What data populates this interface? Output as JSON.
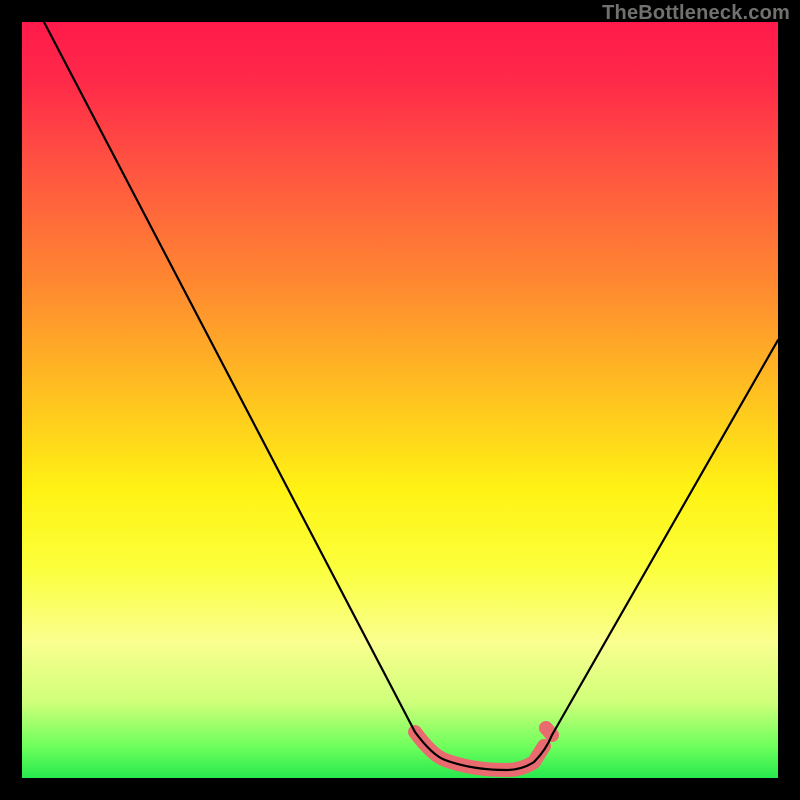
{
  "watermark": "TheBottleneck.com",
  "chart_data": {
    "type": "line",
    "title": "",
    "xlabel": "",
    "ylabel": "",
    "xlim": [
      0,
      100
    ],
    "ylim": [
      0,
      100
    ],
    "grid": false,
    "series": [
      {
        "name": "curve",
        "x": [
          3,
          52,
          55,
          60,
          62,
          64,
          66,
          68,
          70,
          100
        ],
        "values": [
          100,
          6,
          3,
          1.5,
          1,
          1,
          1.5,
          3,
          6,
          58
        ]
      },
      {
        "name": "highlight-band",
        "x": [
          52,
          55,
          60,
          64,
          66,
          68,
          70
        ],
        "values": [
          6,
          3,
          1.5,
          1,
          1.5,
          3,
          6
        ]
      }
    ],
    "background_gradient": {
      "top": "#ff1a4b",
      "bottom": "#27e84e"
    }
  }
}
